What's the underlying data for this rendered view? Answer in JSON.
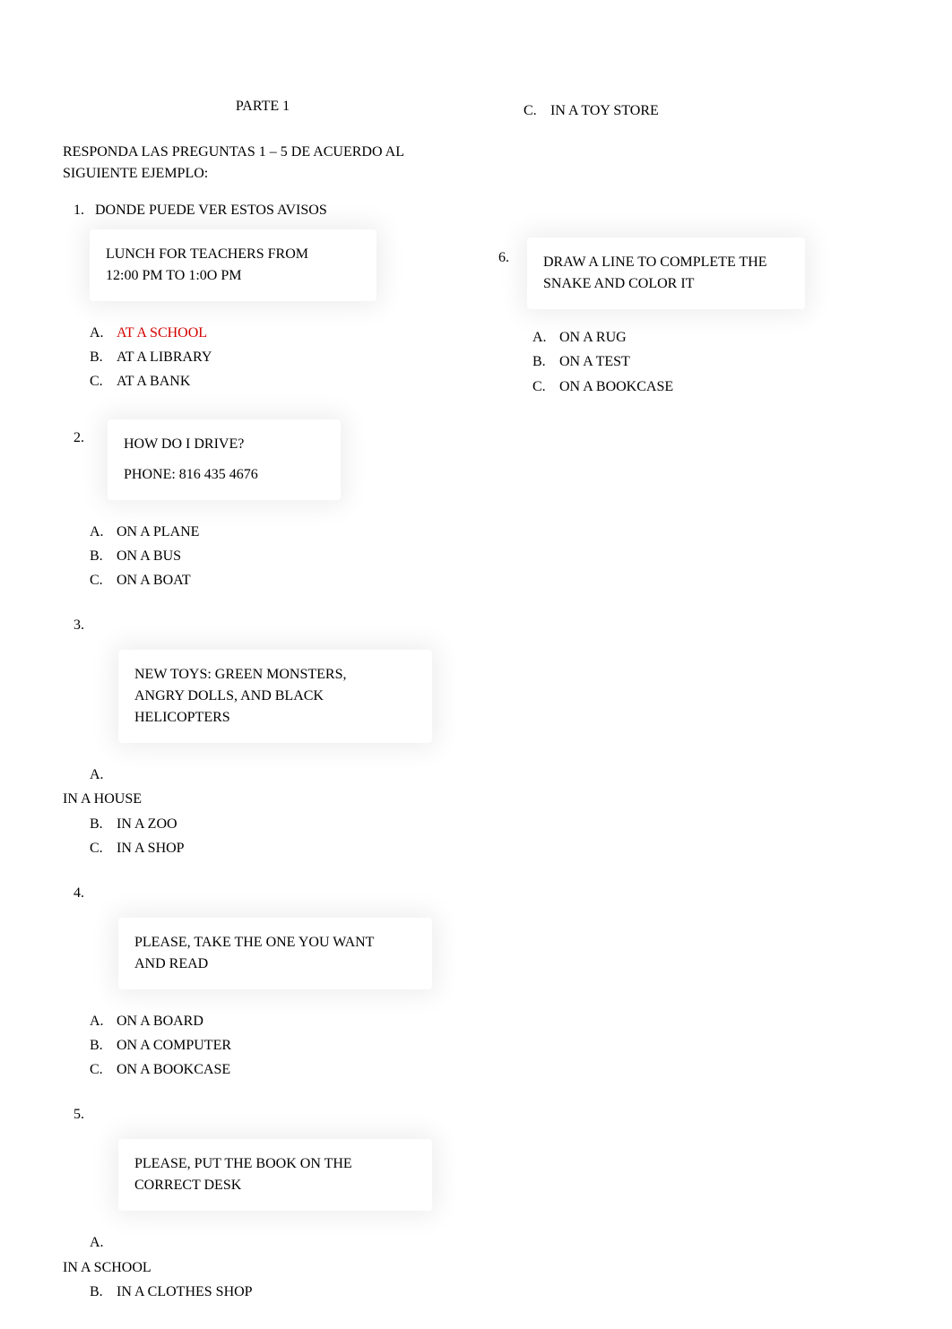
{
  "part_title": "PARTE 1",
  "instructions": "RESPONDA LAS PREGUNTAS 1 – 5 DE ACUERDO AL SIGUIENTE EJEMPLO:",
  "q1": {
    "number": "1.",
    "prompt": "DONDE PUEDE VER ESTOS AVISOS",
    "box_l1": "LUNCH FOR TEACHERS FROM",
    "box_l2": "12:00 PM TO 1:0O PM",
    "optA": {
      "letter": "A.",
      "text": "AT A SCHOOL"
    },
    "optB": {
      "letter": "B.",
      "text": "AT A LIBRARY"
    },
    "optC": {
      "letter": "C.",
      "text": "AT A BANK"
    }
  },
  "q2": {
    "number": "2.",
    "box_l1": "HOW DO I DRIVE?",
    "box_l2": "PHONE: 816 435 4676",
    "optA": {
      "letter": "A.",
      "text": "ON A PLANE"
    },
    "optB": {
      "letter": "B.",
      "text": "ON A BUS"
    },
    "optC": {
      "letter": "C.",
      "text": "ON A BOAT"
    }
  },
  "q3": {
    "number": "3.",
    "box_l1": "NEW TOYS: GREEN MONSTERS,",
    "box_l2": "ANGRY DOLLS, AND BLACK",
    "box_l3": "HELICOPTERS",
    "optA": {
      "letter": "A.",
      "text": "IN A HOUSE"
    },
    "optB": {
      "letter": "B.",
      "text": "IN A ZOO"
    },
    "optC": {
      "letter": "C.",
      "text": "IN A SHOP"
    }
  },
  "q4": {
    "number": "4.",
    "box_l1": "PLEASE, TAKE THE ONE YOU WANT",
    "box_l2": "AND READ",
    "optA": {
      "letter": "A.",
      "text": "ON A BOARD"
    },
    "optB": {
      "letter": "B.",
      "text": "ON A COMPUTER"
    },
    "optC": {
      "letter": "C.",
      "text": "ON A BOOKCASE"
    }
  },
  "q5": {
    "number": "5.",
    "box_l1": "PLEASE, PUT THE BOOK ON THE",
    "box_l2": "CORRECT DESK",
    "optA": {
      "letter": "A.",
      "text": "IN A SCHOOL"
    },
    "optB": {
      "letter": "B.",
      "text": "IN A CLOTHES SHOP"
    },
    "optC": {
      "letter": "C.",
      "text": "IN A TOY STORE"
    }
  },
  "q6": {
    "number": "6.",
    "box_l1": "DRAW A LINE TO COMPLETE THE",
    "box_l2": "SNAKE AND COLOR IT",
    "optA": {
      "letter": "A.",
      "text": "ON A RUG"
    },
    "optB": {
      "letter": "B.",
      "text": "ON A TEST"
    },
    "optC": {
      "letter": "C.",
      "text": "ON A BOOKCASE"
    }
  }
}
